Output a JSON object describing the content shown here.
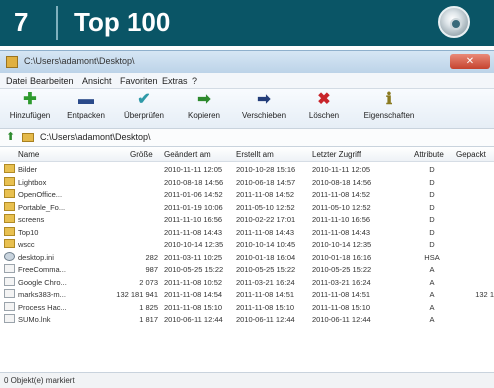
{
  "banner": {
    "number": "7",
    "title": "Top 100",
    "disc_icon": "cd-disc-icon"
  },
  "window": {
    "title_path": "C:\\Users\\adamont\\Desktop\\",
    "close_label": "✕"
  },
  "menu": [
    "Datei",
    "Bearbeiten",
    "Ansicht",
    "Favoriten",
    "Extras",
    "?"
  ],
  "toolbar": [
    {
      "label": "Hinzufügen",
      "icon": "plus-icon",
      "glyph": "✚",
      "color": "#2e9a2e"
    },
    {
      "label": "Entpacken",
      "icon": "minus-icon",
      "glyph": "▬",
      "color": "#2a4a8a"
    },
    {
      "label": "Überprüfen",
      "icon": "check-icon",
      "glyph": "✔",
      "color": "#2f9aa8"
    },
    {
      "label": "Kopieren",
      "icon": "arrow-right-green-icon",
      "glyph": "➡",
      "color": "#2e8a2e"
    },
    {
      "label": "Verschieben",
      "icon": "arrow-right-blue-icon",
      "glyph": "➡",
      "color": "#243e7a"
    },
    {
      "label": "Löschen",
      "icon": "delete-x-icon",
      "glyph": "✖",
      "color": "#c8242a"
    },
    {
      "label": "Eigenschaften",
      "icon": "properties-icon",
      "glyph": "ℹ",
      "color": "#8a7a20"
    }
  ],
  "address": {
    "value": "C:\\Users\\adamont\\Desktop\\"
  },
  "columns": [
    "Name",
    "Größe",
    "Geändert am",
    "Erstellt am",
    "Letzter Zugriff",
    "Attribute",
    "Gepackt"
  ],
  "rows": [
    {
      "type": "folder",
      "name": "Bilder",
      "size": "",
      "modified": "2010-11-11 12:05",
      "created": "2010-10-28 15:16",
      "accessed": "2010-11-11 12:05",
      "attr": "D",
      "packed": ""
    },
    {
      "type": "folder",
      "name": "Lightbox",
      "size": "",
      "modified": "2010-08-18 14:56",
      "created": "2010-06-18 14:57",
      "accessed": "2010-08-18 14:56",
      "attr": "D",
      "packed": ""
    },
    {
      "type": "folder",
      "name": "OpenOffice...",
      "size": "",
      "modified": "2011-01-06 14:52",
      "created": "2011-11-08 14:52",
      "accessed": "2011-11-08 14:52",
      "attr": "D",
      "packed": ""
    },
    {
      "type": "folder",
      "name": "Portable_Fo...",
      "size": "",
      "modified": "2011-01-19 10:06",
      "created": "2011-05-10 12:52",
      "accessed": "2011-05-10 12:52",
      "attr": "D",
      "packed": ""
    },
    {
      "type": "folder",
      "name": "screens",
      "size": "",
      "modified": "2011-11-10 16:56",
      "created": "2010-02-22 17:01",
      "accessed": "2011-11-10 16:56",
      "attr": "D",
      "packed": ""
    },
    {
      "type": "folder",
      "name": "Top10",
      "size": "",
      "modified": "2011-11-08 14:43",
      "created": "2011-11-08 14:43",
      "accessed": "2011-11-08 14:43",
      "attr": "D",
      "packed": ""
    },
    {
      "type": "folder",
      "name": "wscc",
      "size": "",
      "modified": "2010-10-14 12:35",
      "created": "2010-10-14 10:45",
      "accessed": "2010-10-14 12:35",
      "attr": "D",
      "packed": ""
    },
    {
      "type": "gear",
      "name": "desktop.ini",
      "size": "282",
      "modified": "2011-03-11 10:25",
      "created": "2010-01-18 16:04",
      "accessed": "2010-01-18 16:16",
      "attr": "HSA",
      "packed": ""
    },
    {
      "type": "file",
      "name": "FreeComma...",
      "size": "987",
      "modified": "2010-05-25 15:22",
      "created": "2010-05-25 15:22",
      "accessed": "2010-05-25 15:22",
      "attr": "A",
      "packed": ""
    },
    {
      "type": "file",
      "name": "Google Chro...",
      "size": "2 073",
      "modified": "2011-11-08 10:52",
      "created": "2011-03-21 16:24",
      "accessed": "2011-03-21 16:24",
      "attr": "A",
      "packed": ""
    },
    {
      "type": "file",
      "name": "marks383-m...",
      "size": "132 181 941",
      "modified": "2011-11-08 14:54",
      "created": "2011-11-08 14:51",
      "accessed": "2011-11-08 14:51",
      "attr": "A",
      "packed": "132 1"
    },
    {
      "type": "file",
      "name": "Process Hac...",
      "size": "1 825",
      "modified": "2011-11-08 15:10",
      "created": "2011-11-08 15:10",
      "accessed": "2011-11-08 15:10",
      "attr": "A",
      "packed": ""
    },
    {
      "type": "file",
      "name": "SUMo.lnk",
      "size": "1 817",
      "modified": "2010-06-11 12:44",
      "created": "2010-06-11 12:44",
      "accessed": "2010-06-11 12:44",
      "attr": "A",
      "packed": ""
    }
  ],
  "status": {
    "text": "0 Objekt(e) markiert"
  }
}
